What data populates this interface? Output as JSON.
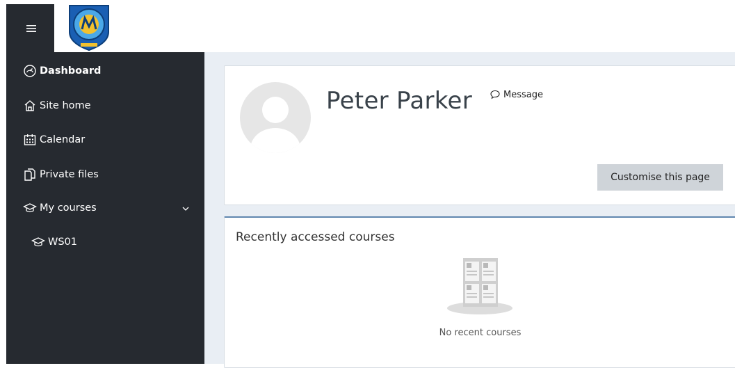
{
  "sidebar": {
    "items": [
      {
        "label": "Dashboard",
        "icon": "dashboard-icon"
      },
      {
        "label": "Site home",
        "icon": "home-icon"
      },
      {
        "label": "Calendar",
        "icon": "calendar-icon"
      },
      {
        "label": "Private files",
        "icon": "files-icon"
      },
      {
        "label": "My courses",
        "icon": "graduation-cap-icon"
      },
      {
        "label": "WS01",
        "icon": "graduation-cap-icon"
      }
    ]
  },
  "profile": {
    "name": "Peter Parker",
    "message_label": "Message",
    "customise_label": "Customise this page"
  },
  "recent_courses": {
    "title": "Recently accessed courses",
    "empty_text": "No recent courses"
  },
  "colors": {
    "sidebar_bg": "#262a30",
    "main_bg": "#e9eef4",
    "accent_border": "#5f86ae",
    "button_bg": "#cfd4d9"
  }
}
